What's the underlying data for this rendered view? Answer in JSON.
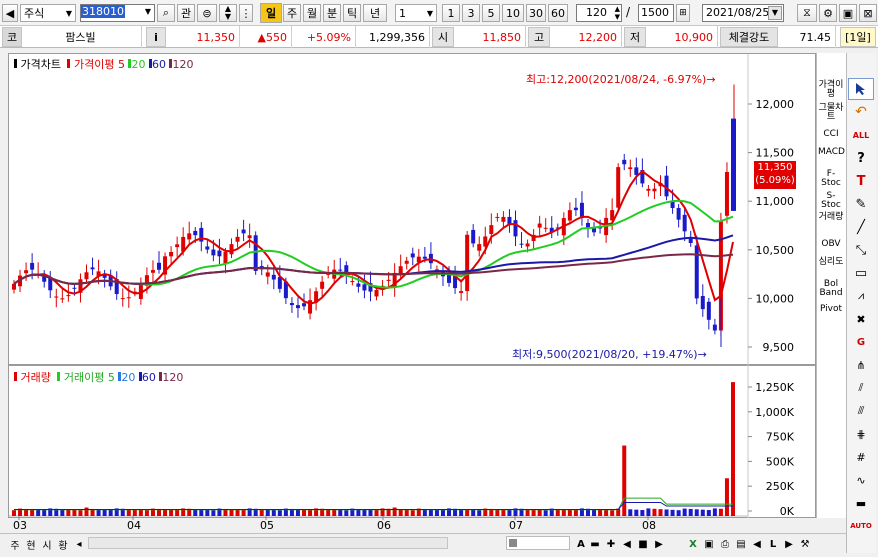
{
  "toolbar": {
    "market_select": "주식",
    "code_input": "318010",
    "btn_kwan": "관",
    "period_active": "일",
    "periods": [
      "주",
      "월",
      "분",
      "틱",
      "년"
    ],
    "unit_value": "1",
    "quick_units": [
      "1",
      "3",
      "5",
      "10",
      "30",
      "60"
    ],
    "count_value": "120",
    "total_count": "1500",
    "date_value": "2021/08/25"
  },
  "quote": {
    "code_label": "코",
    "stock_name": "팜스빌",
    "info_icon": "i",
    "price": "11,350",
    "change": "▲550",
    "change_pct": "+5.09%",
    "volume": "1,299,356",
    "open_label": "시",
    "open_value": "11,850",
    "high_label": "고",
    "high_value": "12,200",
    "low_label": "저",
    "low_value": "10,900",
    "strength_label": "체결강도",
    "strength_value": "71.45",
    "period_badge": "[1일]"
  },
  "price_panel": {
    "title": "가격차트",
    "ma_title": "가격이평",
    "ma_periods": [
      "5",
      "20",
      "60",
      "120"
    ],
    "high_annotation": "최고:12,200(2021/08/24, -6.97%)→",
    "low_annotation": "최저:9,500(2021/08/20, +19.47%)→",
    "current_price_tag": "11,350",
    "current_pct_tag": "(5.09%)"
  },
  "volume_panel": {
    "title": "거래량",
    "ma_title": "거래이평",
    "ma_periods": [
      "5",
      "20",
      "60",
      "120"
    ]
  },
  "colors": {
    "up": "#e00000",
    "down": "#1a1acc",
    "ma5": "#e00000",
    "ma20": "#22cc22",
    "ma60": "#1a1aaa",
    "ma120": "#7a2848",
    "toolbar_highlight": "#f5c518"
  },
  "chart_data": [
    {
      "type": "candlestick",
      "title": "가격차트",
      "y_ticks": [
        "12,000",
        "11,500",
        "11,000",
        "10,500",
        "10,000",
        "9,500"
      ],
      "ylim": [
        9400,
        12300
      ],
      "x_ticks": [
        "03",
        "04",
        "05",
        "06",
        "07",
        "08"
      ],
      "highest": {
        "value": 12200,
        "date": "2021/08/24"
      },
      "lowest": {
        "value": 9500,
        "date": "2021/08/20"
      },
      "series": [
        {
          "name": "5",
          "kind": "MA"
        },
        {
          "name": "20",
          "kind": "MA"
        },
        {
          "name": "60",
          "kind": "MA"
        },
        {
          "name": "120",
          "kind": "MA"
        }
      ]
    },
    {
      "type": "bar",
      "title": "거래량",
      "y_ticks": [
        "1,250K",
        "1,000K",
        "750K",
        "500K",
        "250K",
        "0K"
      ],
      "ylim": [
        0,
        1320000
      ],
      "peaks": [
        {
          "month": "07",
          "value": 660000
        },
        {
          "month": "08",
          "value": 1299356
        }
      ]
    }
  ],
  "right_tools": [
    "가격이평",
    "그물차트",
    "CCI",
    "MACD",
    "F-Stoc",
    "S-Stoc",
    "거래량",
    "OBV",
    "심리도",
    "Bol Band",
    "Pivot"
  ],
  "bottom": {
    "tabs": [
      "주",
      "현",
      "시",
      "황"
    ],
    "letter": "A"
  }
}
